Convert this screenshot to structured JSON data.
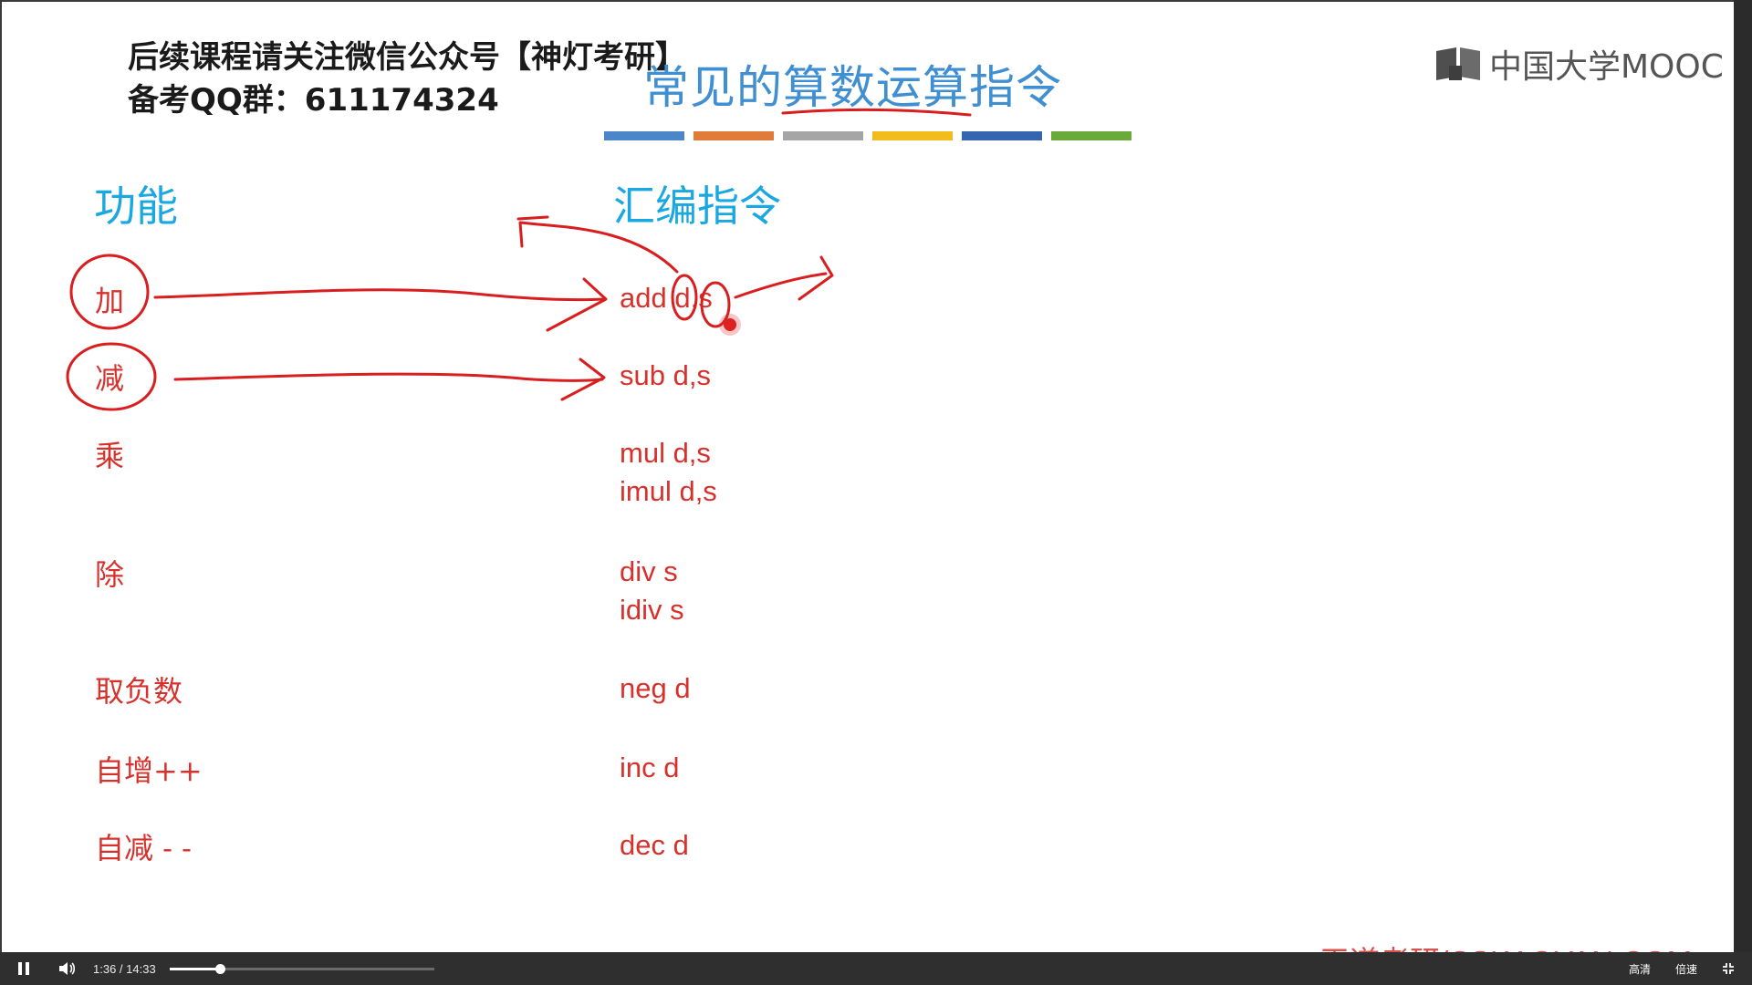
{
  "notice": {
    "line1": "后续课程请关注微信公众号【神灯考研】",
    "line2": "备考QQ群：611174324"
  },
  "slide": {
    "title": "常见的算数运算指令",
    "color_bars": [
      "#4a86c8",
      "#e07b39",
      "#a5a5a5",
      "#f2bd1c",
      "#3465b0",
      "#6aaa3a"
    ],
    "logo_text": "中国大学MOOC",
    "col_function": "功能",
    "col_assembly": "汇编指令",
    "rows": [
      {
        "func": "加",
        "asm": [
          "add d,s"
        ]
      },
      {
        "func": "减",
        "asm": [
          "sub d,s"
        ]
      },
      {
        "func": "乘",
        "asm": [
          "mul d,s",
          "imul d,s"
        ]
      },
      {
        "func": "除",
        "asm": [
          "div s",
          "idiv s"
        ]
      },
      {
        "func": "取负数",
        "asm": [
          "neg d"
        ]
      },
      {
        "func": "自增++",
        "asm": [
          "inc d"
        ]
      },
      {
        "func": "自减 - -",
        "asm": [
          "dec d"
        ]
      }
    ],
    "watermark": "王道考研/CSKAOYAN.COM"
  },
  "player": {
    "current_time": "1:36",
    "duration": "14:33",
    "progress": 0.11,
    "quality_label": "高清",
    "speed_label": "倍速",
    "colors": {
      "bar": "#2f2f2f",
      "accent": "#ffffff"
    }
  }
}
